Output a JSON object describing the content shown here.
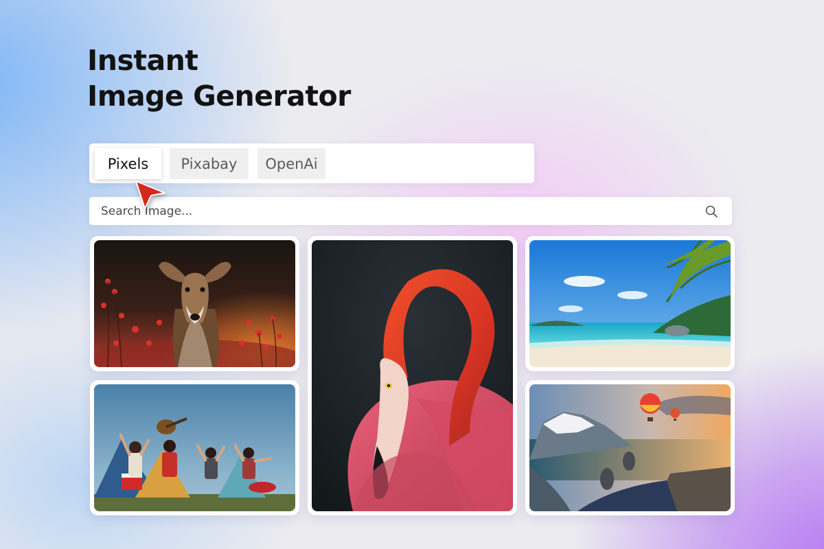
{
  "header": {
    "title_line1": "Instant",
    "title_line2": "Image Generator"
  },
  "tabs": [
    {
      "label": "Pixels",
      "active": true
    },
    {
      "label": "Pixabay",
      "active": false
    },
    {
      "label": "OpenAi",
      "active": false
    }
  ],
  "search": {
    "placeholder": "Search Image...",
    "value": "",
    "icon": "search-icon"
  },
  "gallery": {
    "images": [
      {
        "subject": "deer-in-red-berries"
      },
      {
        "subject": "friends-camping-with-guitar"
      },
      {
        "subject": "red-flamingo"
      },
      {
        "subject": "tropical-beach-with-palm"
      },
      {
        "subject": "hot-air-balloons-over-fjord"
      }
    ]
  },
  "colors": {
    "pointer": "#d4281c",
    "title": "#121212",
    "gradient_blue": "#7fb6f6",
    "gradient_purple": "#b77af2"
  }
}
